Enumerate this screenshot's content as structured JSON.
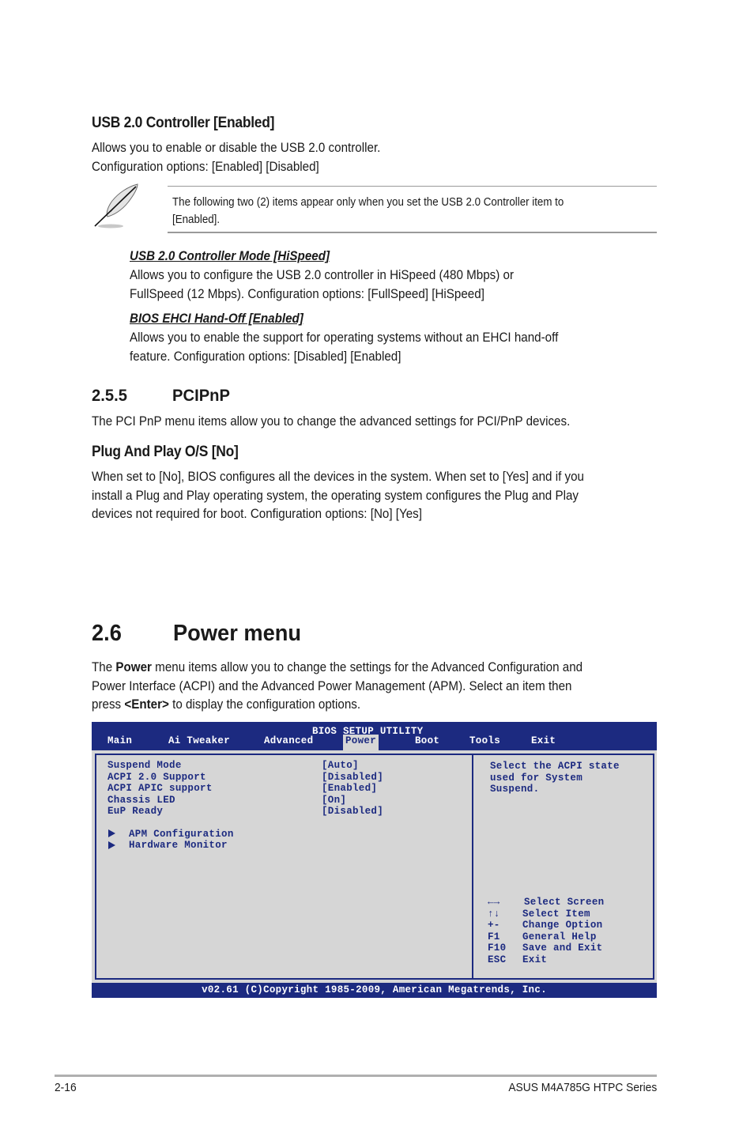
{
  "usb_controller": {
    "heading": "USB 2.0 Controller [Enabled]",
    "lines": [
      "Allows you to enable or disable the USB 2.0 controller.",
      "Configuration options: [Enabled] [Disabled]"
    ]
  },
  "note": {
    "icon": "feather-quill-icon",
    "lines": [
      "The following two (2) items appear only when you set the USB 2.0 Controller item to",
      "[Enabled]."
    ]
  },
  "controller_mode": {
    "heading": "USB 2.0 Controller Mode [HiSpeed]",
    "lines": [
      "Allows you to configure the USB 2.0 controller in HiSpeed (480 Mbps) or",
      "FullSpeed (12 Mbps). Configuration options: [FullSpeed] [HiSpeed]"
    ]
  },
  "ehci": {
    "heading": "BIOS EHCI Hand-Off [Enabled]",
    "lines": [
      "Allows you to enable the support for operating systems without an EHCI hand-off",
      "feature. Configuration options: [Disabled] [Enabled]"
    ]
  },
  "pcipnp": {
    "number": "2.5.5",
    "title": "PCIPnP",
    "intro": "The PCI PnP menu items allow you to change the advanced settings for PCI/PnP devices."
  },
  "plug_and_play": {
    "heading": "Plug And Play O/S [No]",
    "lines": [
      "When set to [No], BIOS configures all the devices in the system. When set to [Yes] and if you",
      "install a Plug and Play operating system, the operating system configures the Plug and Play",
      "devices not required for boot. Configuration options: [No] [Yes]"
    ]
  },
  "power_menu": {
    "number": "2.6",
    "title": "Power menu",
    "intro": {
      "line1_pre": "The ",
      "line1_bold": "Power",
      "line1_post": " menu items allow you to change the settings for the Advanced Configuration and",
      "line2": "Power Interface (ACPI) and the Advanced Power Management (APM). Select an item then",
      "line3_pre": "press ",
      "line3_bold": "<Enter>",
      "line3_post": " to display the configuration options."
    }
  },
  "bios": {
    "title": "BIOS SETUP UTILITY",
    "tabs": [
      "Main",
      "Ai Tweaker",
      "Advanced",
      "Power",
      "Boot",
      "Tools",
      "Exit"
    ],
    "active_tab": "Power",
    "items": [
      {
        "label": "Suspend Mode",
        "value": "[Auto]"
      },
      {
        "label": "ACPI 2.0 Support",
        "value": "[Disabled]"
      },
      {
        "label": "ACPI APIC support",
        "value": "[Enabled]"
      },
      {
        "label": "Chassis LED",
        "value": "[On]"
      },
      {
        "label": "EuP Ready",
        "value": "[Disabled]"
      }
    ],
    "submenus": [
      "APM Configuration",
      "Hardware Monitor"
    ],
    "help_lines": [
      "Select the ACPI state",
      "used for System",
      "Suspend."
    ],
    "keys": [
      {
        "key": "←→",
        "action": "Select Screen"
      },
      {
        "key": "↑↓",
        "action": "Select Item"
      },
      {
        "key": "+-",
        "action": "Change Option"
      },
      {
        "key": "F1",
        "action": "General Help"
      },
      {
        "key": "F10",
        "action": "Save and Exit"
      },
      {
        "key": "ESC",
        "action": "Exit"
      }
    ],
    "footer": "v02.61 (C)Copyright 1985-2009, American Megatrends, Inc.",
    "colors": {
      "primary": "#1c2a80",
      "background": "#d6d6d6"
    }
  },
  "page_footer": {
    "page_number": "2-16",
    "product": "ASUS M4A785G HTPC Series"
  }
}
